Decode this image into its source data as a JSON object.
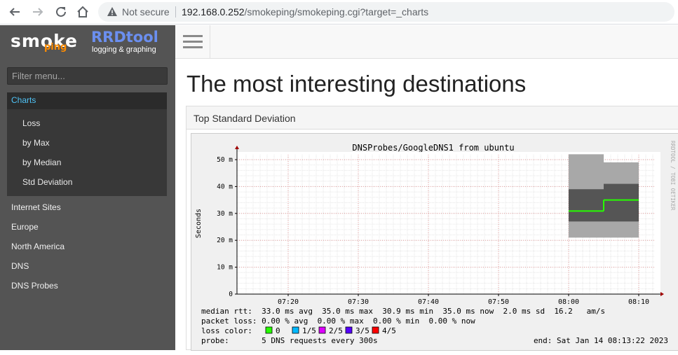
{
  "browser": {
    "back_icon": "back-arrow-icon",
    "forward_icon": "forward-arrow-icon",
    "reload_icon": "reload-icon",
    "home_icon": "home-icon",
    "warning_icon": "warning-icon",
    "security_text": "Not secure",
    "url_host": "192.168.0.252",
    "url_path": "/smokeping/smokeping.cgi?target=_charts"
  },
  "logo": {
    "smoke": "smoke",
    "ping": "ping",
    "rrd": "RRDtool",
    "rrd_sub": "logging & graphing"
  },
  "sidebar": {
    "filter_placeholder": "Filter menu...",
    "active": "Charts",
    "sub_items": [
      "Loss",
      "by Max",
      "by Median",
      "Std Deviation"
    ],
    "items": [
      "Internet Sites",
      "Europe",
      "North America",
      "DNS",
      "DNS Probes"
    ]
  },
  "header": {
    "menu_icon": "hamburger-menu-icon"
  },
  "main": {
    "title": "The most interesting destinations",
    "panel_title": "Top Standard Deviation"
  },
  "graph": {
    "title": "DNSProbes/GoogleDNS1 from ubuntu",
    "ylabel": "Seconds",
    "watermark": "RRDTOOL / TOBI OETIKER",
    "yticks": [
      "50 m",
      "40 m",
      "30 m",
      "20 m",
      "10 m",
      "0"
    ],
    "xticks": [
      "07:20",
      "07:30",
      "07:40",
      "07:50",
      "08:00",
      "08:10"
    ],
    "legend_lines": [
      "median rtt:  33.0 ms avg  35.0 ms max  30.9 ms min  35.0 ms now  2.0 ms sd  16.2   am/s",
      "packet loss: 0.00 % avg  0.00 % max  0.00 % min  0.00 % now"
    ],
    "loss_color_label": "loss color:",
    "loss_colors": [
      {
        "label": "0",
        "color": "#26ff00"
      },
      {
        "label": "1/5",
        "color": "#00b8ff"
      },
      {
        "label": "2/5",
        "color": "#dd00ff"
      },
      {
        "label": "3/5",
        "color": "#5500ff"
      },
      {
        "label": "4/5",
        "color": "#ff0000"
      }
    ],
    "probe_text": "probe:       5 DNS requests every 300s",
    "end_text": "end: Sat Jan 14 08:13:22 2023"
  },
  "chart_data": {
    "type": "line",
    "title": "DNSProbes/GoogleDNS1 from ubuntu",
    "xlabel": "",
    "ylabel": "Seconds",
    "ylim": [
      0,
      0.05
    ],
    "x_ticks": [
      "07:20",
      "07:30",
      "07:40",
      "07:50",
      "08:00",
      "08:10"
    ],
    "series": [
      {
        "name": "median rtt",
        "x": [
          "08:00",
          "08:05",
          "08:10"
        ],
        "values": [
          0.0309,
          0.035,
          0.035
        ]
      }
    ],
    "smoke": [
      {
        "x_start": "08:00",
        "x_end": "08:05",
        "low": 0.021,
        "high": 0.052,
        "inner_low": 0.027,
        "inner_high": 0.039
      },
      {
        "x_start": "08:05",
        "x_end": "08:10",
        "low": 0.021,
        "high": 0.049,
        "inner_low": 0.027,
        "inner_high": 0.041
      }
    ],
    "grid": true,
    "series_color": "#26ff00"
  }
}
